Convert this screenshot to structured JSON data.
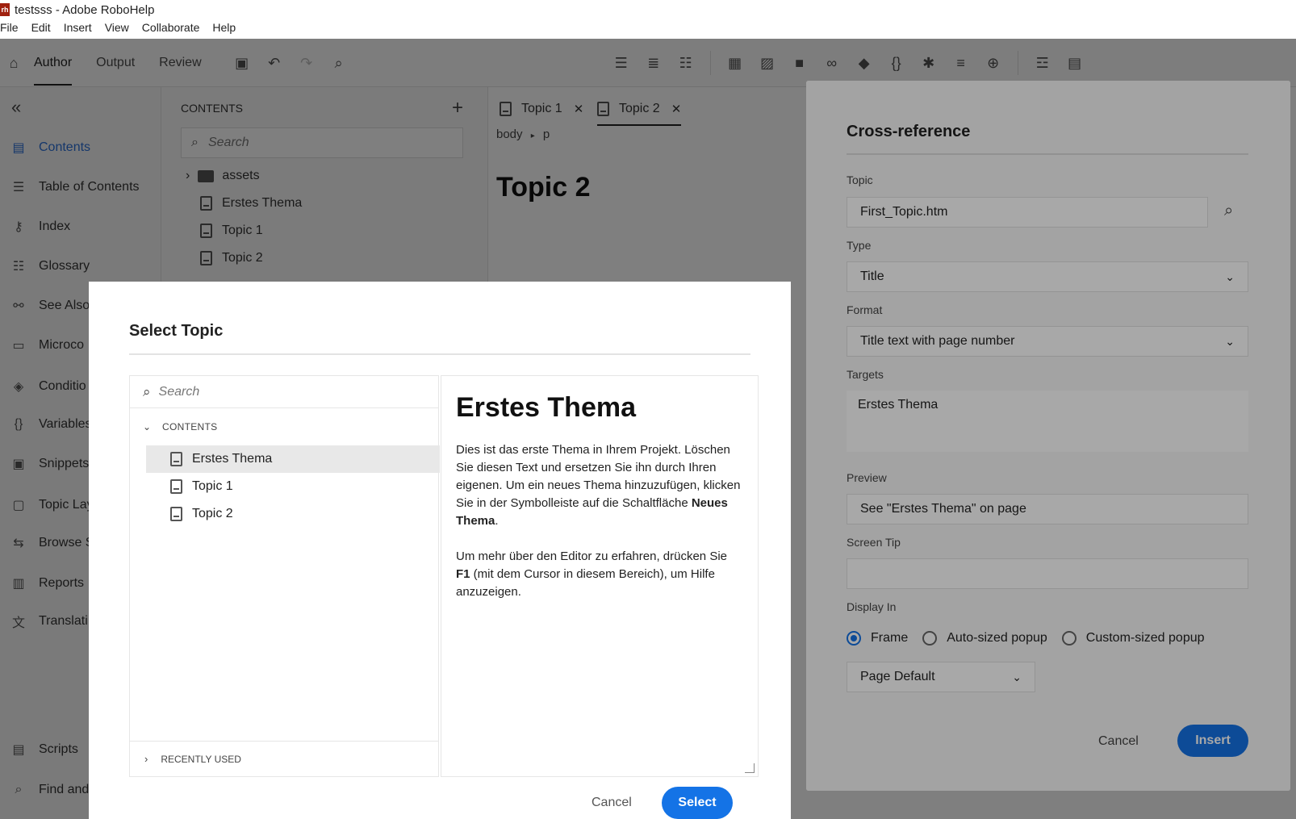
{
  "window": {
    "title": "testsss - Adobe RoboHelp",
    "icon_text": "rh"
  },
  "menu": [
    "File",
    "Edit",
    "Insert",
    "View",
    "Collaborate",
    "Help"
  ],
  "toolbar": {
    "tabs": [
      "Author",
      "Output",
      "Review"
    ]
  },
  "leftnav": {
    "items": [
      "Contents",
      "Table of Contents",
      "Index",
      "Glossary",
      "See Also",
      "Microco",
      "Conditio",
      "Variables",
      "Snippets",
      "Topic Lay",
      "Browse S",
      "Reports",
      "Translati",
      "Scripts",
      "Find and"
    ]
  },
  "contents_panel": {
    "title": "CONTENTS",
    "search_placeholder": "Search",
    "tree": [
      "assets",
      "Erstes Thema",
      "Topic 1",
      "Topic 2"
    ]
  },
  "editor": {
    "tabs": [
      "Topic 1",
      "Topic 2"
    ],
    "breadcrumb": [
      "body",
      "p"
    ],
    "heading": "Topic 2"
  },
  "xref": {
    "title": "Cross-reference",
    "topic_label": "Topic",
    "topic_value": "First_Topic.htm",
    "type_label": "Type",
    "type_value": "Title",
    "format_label": "Format",
    "format_value": "Title text with page number",
    "targets_label": "Targets",
    "targets_value": "Erstes Thema",
    "preview_label": "Preview",
    "preview_value": "See \"Erstes Thema\" on page",
    "screentip_label": "Screen Tip",
    "screentip_value": "",
    "displayin_label": "Display In",
    "radio_options": [
      "Frame",
      "Auto-sized popup",
      "Custom-sized popup"
    ],
    "radio_selected": "Frame",
    "page_value": "Page Default",
    "cancel": "Cancel",
    "insert": "Insert"
  },
  "select_topic": {
    "title": "Select Topic",
    "search_placeholder": "Search",
    "contents_label": "CONTENTS",
    "items": [
      "Erstes Thema",
      "Topic 1",
      "Topic 2"
    ],
    "selected": "Erstes Thema",
    "recently_used": "RECENTLY USED",
    "cancel": "Cancel",
    "select": "Select",
    "preview": {
      "title": "Erstes Thema",
      "para1_a": "Dies ist das erste Thema in Ihrem Projekt. Löschen Sie diesen Text und ersetzen Sie ihn durch Ihren eigenen. Um ein neues Thema hinzuzufügen, klicken Sie in der Symbolleiste auf die Schaltfläche ",
      "para1_bold": "Neues Thema",
      "para1_b": ".",
      "para2_a": "Um mehr über den Editor zu erfahren, drücken Sie ",
      "para2_bold": "F1",
      "para2_b": " (mit dem Cursor in diesem Bereich), um Hilfe anzuzeigen."
    }
  },
  "colors": {
    "accent": "#1473e6",
    "overlay": "rgba(0,0,0,0.5)"
  }
}
